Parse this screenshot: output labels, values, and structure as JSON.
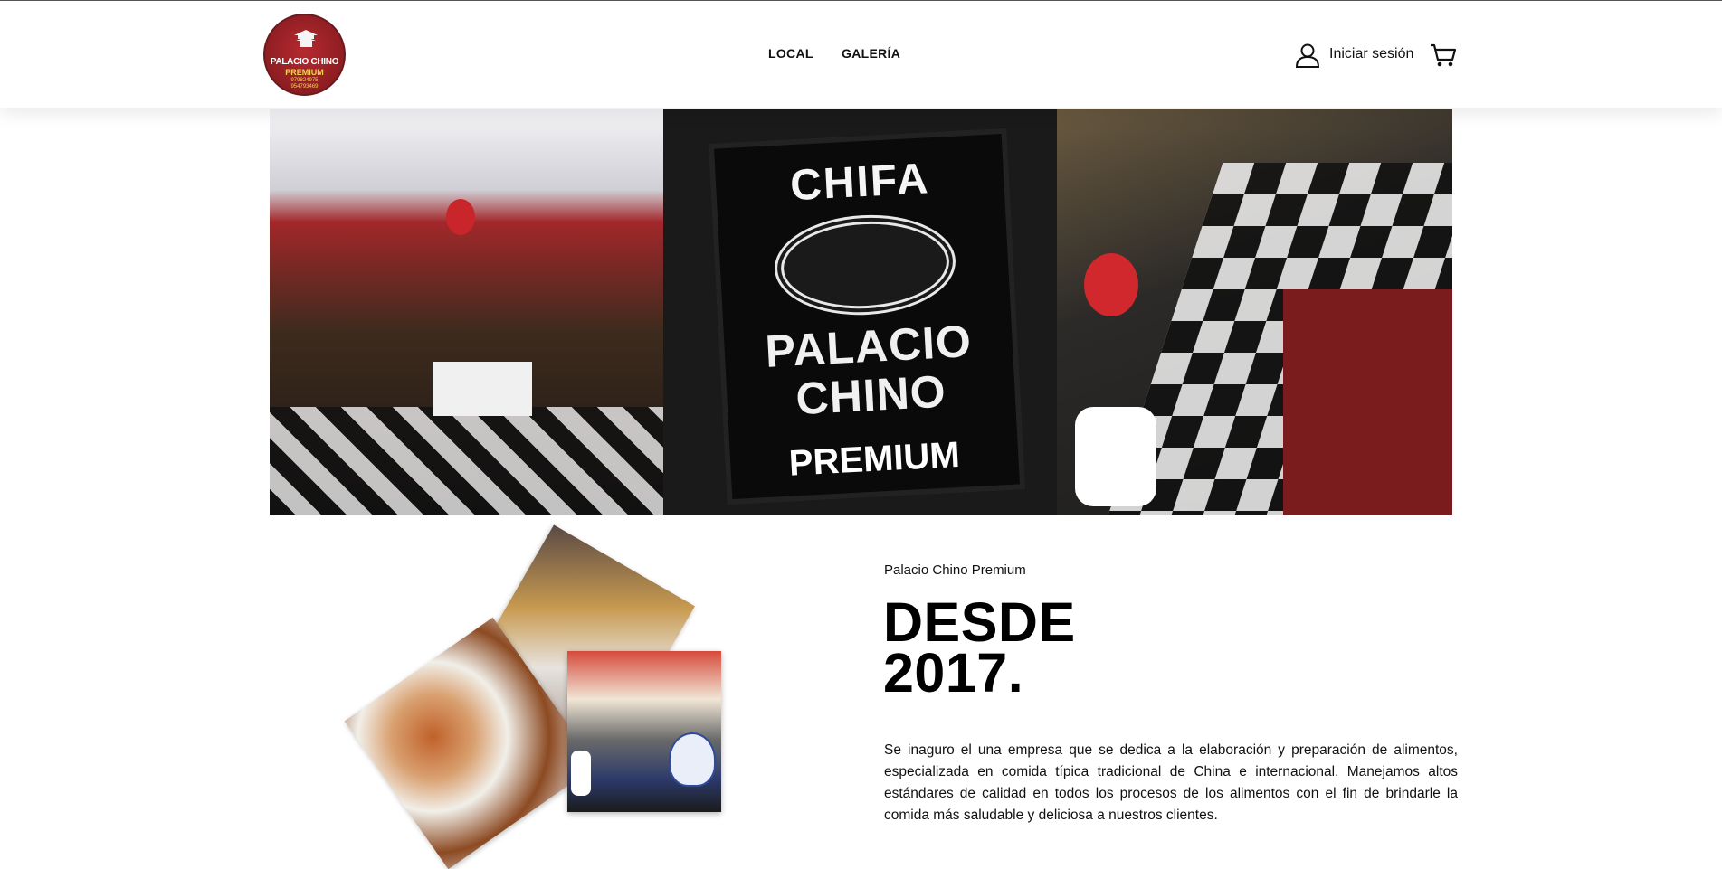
{
  "logo": {
    "name": "PALACIO CHINO",
    "tag": "PREMIUM",
    "phones": [
      "979824975",
      "954793469"
    ]
  },
  "nav": {
    "items": [
      {
        "label": "LOCAL"
      },
      {
        "label": "GALERÍA"
      }
    ]
  },
  "header_actions": {
    "login_label": "Iniciar sesión",
    "user_icon": "user-icon",
    "cart_icon": "cart-icon"
  },
  "gallery": {
    "sign": {
      "line1": "CHIFA",
      "line2": "PALACIO",
      "line3": "CHINO",
      "line4": "PREMIUM"
    }
  },
  "about": {
    "kicker": "Palacio Chino Premium",
    "headline_1": "DESDE",
    "headline_2": "2017.",
    "body": "Se inaguro el una empresa que se dedica a la elaboración y preparación de alimentos, especializada en comida típica tradicional de China e internacional. Manejamos altos estándares de calidad en todos los procesos de los alimentos con el fin de brindarle la comida más saludable y deliciosa a nuestros clientes."
  },
  "colors": {
    "brand_red": "#8d1d22",
    "brand_gold": "#f2d34b",
    "text": "#111111"
  }
}
